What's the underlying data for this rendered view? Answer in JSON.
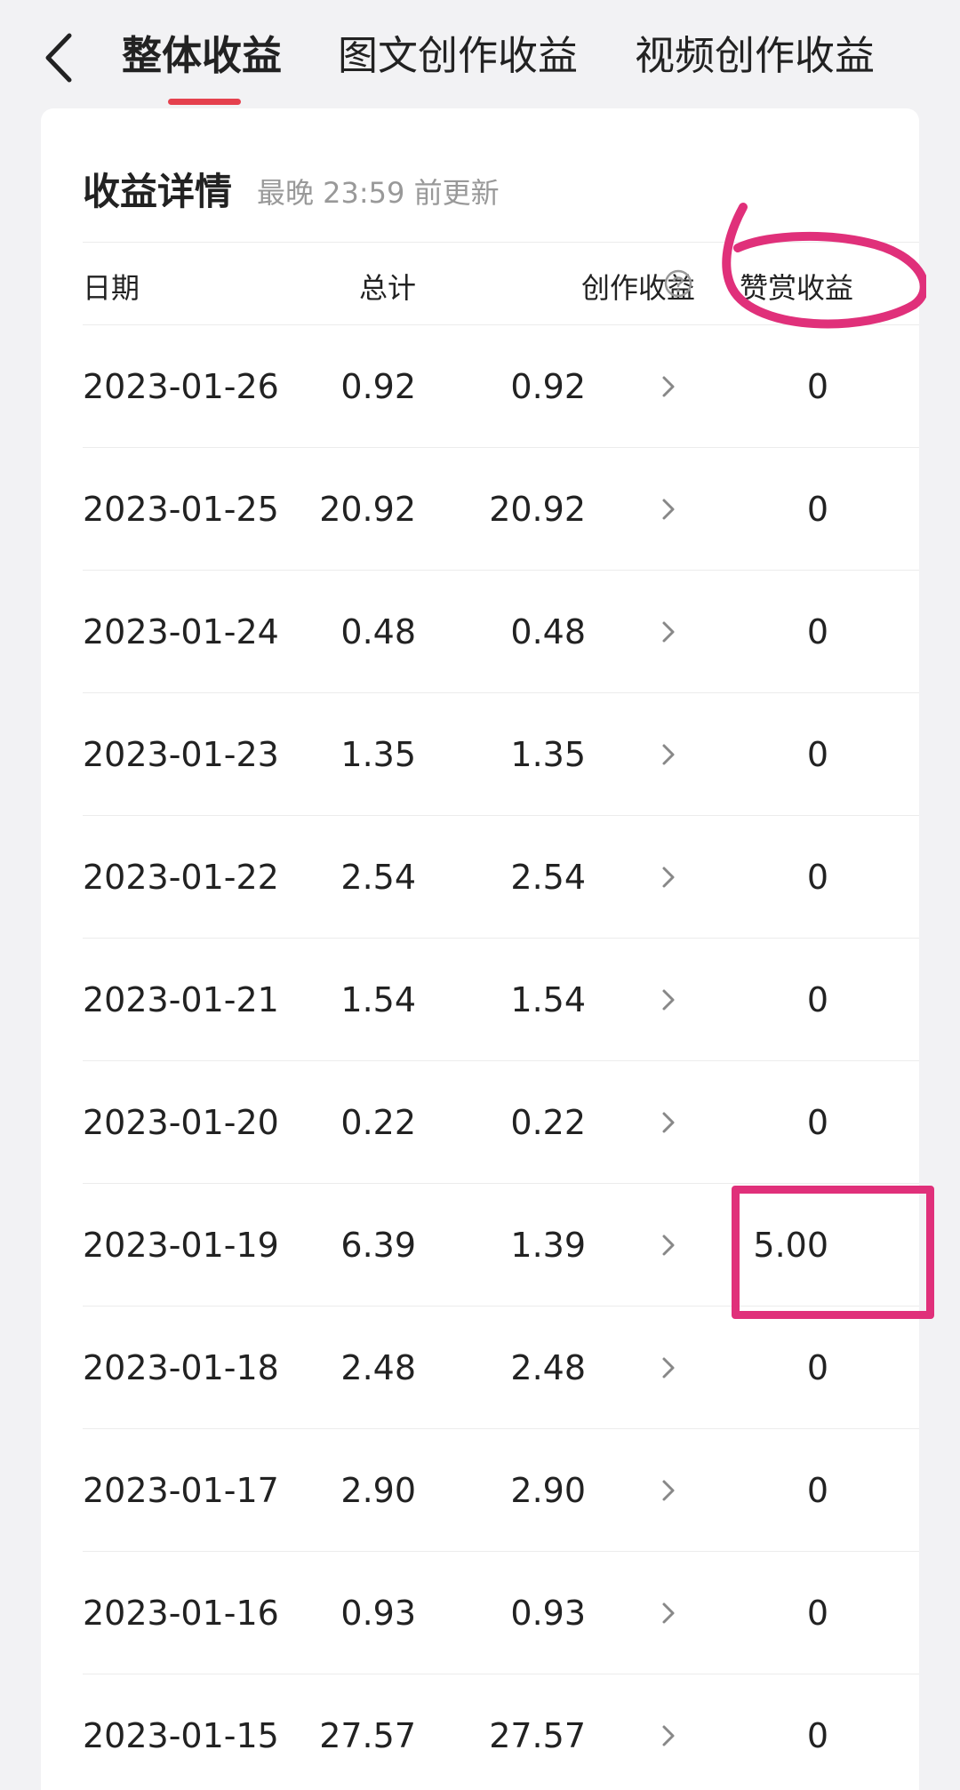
{
  "nav": {
    "tabs": [
      {
        "label": "整体收益",
        "active": true
      },
      {
        "label": "图文创作收益",
        "active": false
      },
      {
        "label": "视频创作收益",
        "active": false
      }
    ]
  },
  "details": {
    "title": "收益详情",
    "subtitle": "最晚 23:59 前更新"
  },
  "table": {
    "headers": {
      "date": "日期",
      "total": "总计",
      "creation": "创作收益",
      "reward": "赞赏收益"
    },
    "rows": [
      {
        "date": "2023-01-26",
        "total": "0.92",
        "creation": "0.92",
        "reward": "0"
      },
      {
        "date": "2023-01-25",
        "total": "20.92",
        "creation": "20.92",
        "reward": "0"
      },
      {
        "date": "2023-01-24",
        "total": "0.48",
        "creation": "0.48",
        "reward": "0"
      },
      {
        "date": "2023-01-23",
        "total": "1.35",
        "creation": "1.35",
        "reward": "0"
      },
      {
        "date": "2023-01-22",
        "total": "2.54",
        "creation": "2.54",
        "reward": "0"
      },
      {
        "date": "2023-01-21",
        "total": "1.54",
        "creation": "1.54",
        "reward": "0"
      },
      {
        "date": "2023-01-20",
        "total": "0.22",
        "creation": "0.22",
        "reward": "0"
      },
      {
        "date": "2023-01-19",
        "total": "6.39",
        "creation": "1.39",
        "reward": "5.00"
      },
      {
        "date": "2023-01-18",
        "total": "2.48",
        "creation": "2.48",
        "reward": "0"
      },
      {
        "date": "2023-01-17",
        "total": "2.90",
        "creation": "2.90",
        "reward": "0"
      },
      {
        "date": "2023-01-16",
        "total": "0.93",
        "creation": "0.93",
        "reward": "0"
      },
      {
        "date": "2023-01-15",
        "total": "27.57",
        "creation": "27.57",
        "reward": "0"
      }
    ]
  },
  "colors": {
    "accent": "#e5414e",
    "annotation": "#e0307a"
  },
  "icons": {
    "back": "chevron-left-icon",
    "help": "question-circle-icon",
    "row_arrow": "chevron-right-icon"
  }
}
